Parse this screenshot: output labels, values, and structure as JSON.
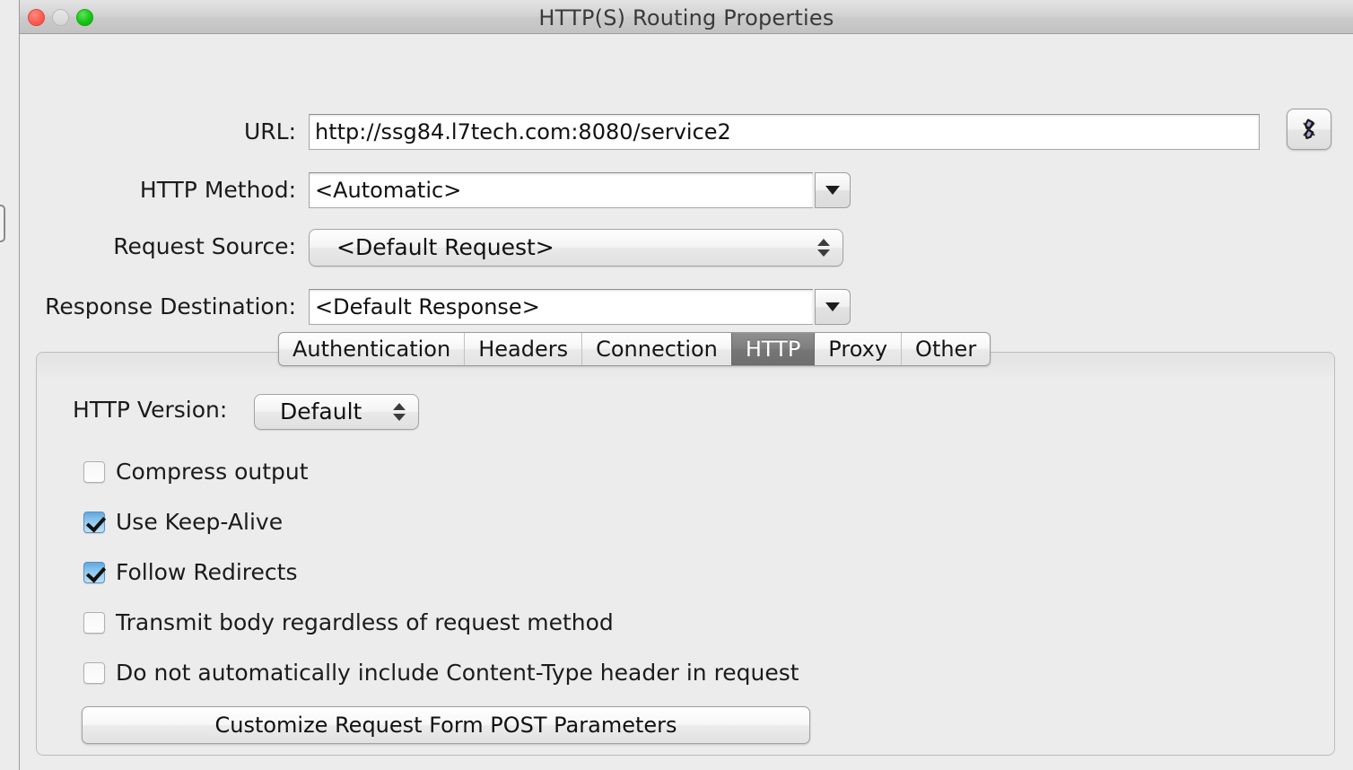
{
  "window": {
    "title": "HTTP(S) Routing Properties",
    "traffic_lights": {
      "close": "close-button",
      "minimize": "minimize-button",
      "zoom": "zoom-button"
    }
  },
  "form": {
    "url": {
      "label": "URL:",
      "value": "http://ssg84.l7tech.com:8080/service2",
      "variable_button_icon": "chain-link-icon"
    },
    "http_method": {
      "label": "HTTP Method:",
      "value": "<Automatic>"
    },
    "request_source": {
      "label": "Request Source:",
      "value": "<Default Request>"
    },
    "response_destination": {
      "label": "Response Destination:",
      "value": "<Default Response>"
    }
  },
  "tabs": [
    {
      "label": "Authentication",
      "selected": false
    },
    {
      "label": "Headers",
      "selected": false
    },
    {
      "label": "Connection",
      "selected": false
    },
    {
      "label": "HTTP",
      "selected": true
    },
    {
      "label": "Proxy",
      "selected": false
    },
    {
      "label": "Other",
      "selected": false
    }
  ],
  "http_panel": {
    "version_label": "HTTP Version:",
    "version_value": "Default",
    "checkboxes": [
      {
        "label": "Compress output",
        "checked": false
      },
      {
        "label": "Use Keep-Alive",
        "checked": true
      },
      {
        "label": "Follow Redirects",
        "checked": true
      },
      {
        "label": "Transmit body regardless of request method",
        "checked": false
      },
      {
        "label": "Do not automatically include Content-Type header in request",
        "checked": false
      }
    ],
    "customize_button": "Customize Request Form POST Parameters"
  },
  "colors": {
    "window_bg": "#ececec",
    "titlebar_top": "#e4e4e4",
    "titlebar_bottom": "#c2c2c2",
    "selected_tab_bg": "#7b7b7b",
    "checkbox_on": "#8fc8ef",
    "close_red": "#ff5f52",
    "zoom_green": "#16c516",
    "link_icon_purple": "#9d9ad4"
  }
}
